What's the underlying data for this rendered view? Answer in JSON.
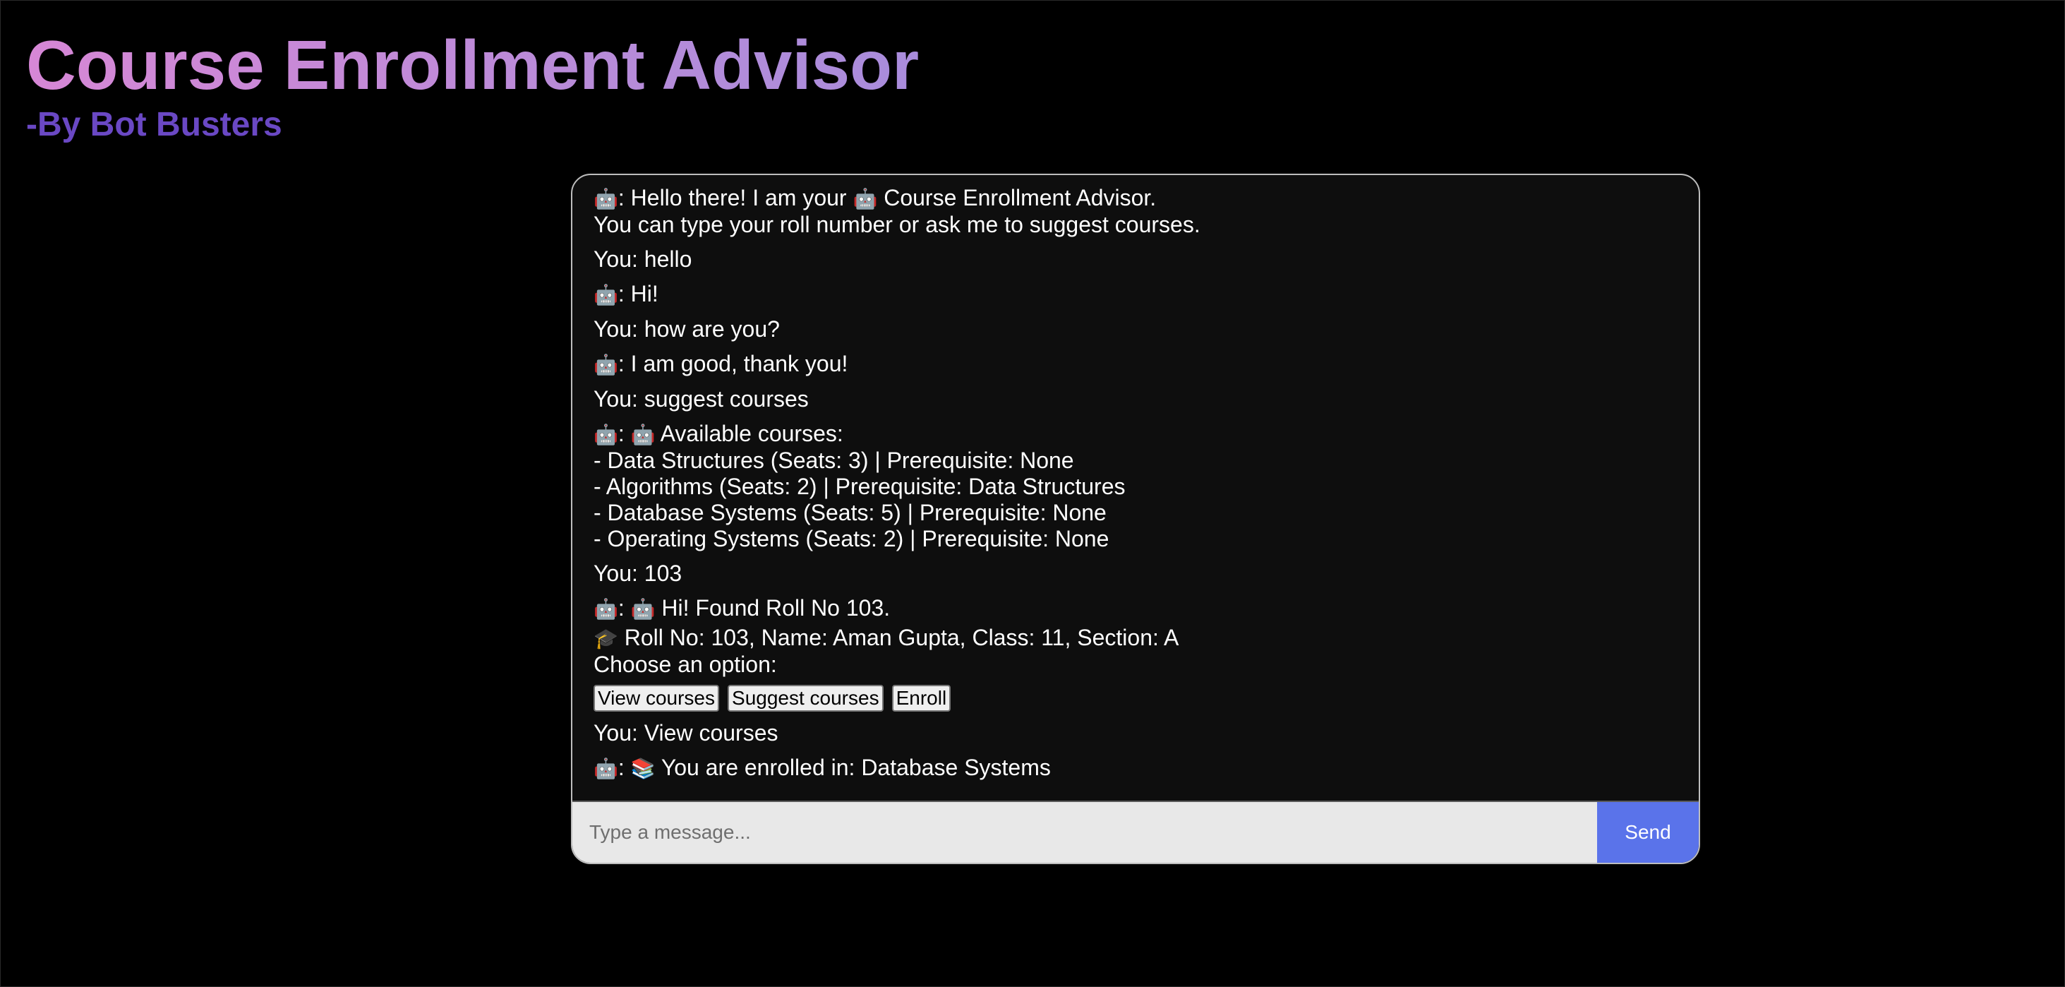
{
  "header": {
    "title": "Course Enrollment Advisor",
    "subtitle": "-By Bot Busters"
  },
  "icons": {
    "bot": "🤖",
    "grad_cap": "🎓",
    "books": "📚"
  },
  "chat": {
    "messages": [
      {
        "line1": ": Hello there! I am your ",
        "line1b": " Course Enrollment Advisor.",
        "line2": "You can type your roll number or ask me to suggest courses."
      },
      {
        "text": "You: hello"
      },
      {
        "text": ": Hi!"
      },
      {
        "text": "You: how are you?"
      },
      {
        "text": ": I am good, thank you!"
      },
      {
        "text": "You: suggest courses"
      },
      {
        "head": " Available courses:",
        "lines": [
          "- Data Structures (Seats: 3) | Prerequisite: None",
          "- Algorithms (Seats: 2) | Prerequisite: Data Structures",
          "- Database Systems (Seats: 5) | Prerequisite: None",
          "- Operating Systems (Seats: 2) | Prerequisite: None"
        ]
      },
      {
        "text": "You: 103"
      },
      {
        "head": " Hi! Found Roll No 103.",
        "line2": " Roll No: 103, Name: Aman Gupta, Class: 11, Section: A",
        "line3": "Choose an option:"
      },
      {
        "text": "You: View courses"
      },
      {
        "text": " You are enrolled in: Database Systems"
      }
    ],
    "options": [
      "View courses",
      "Suggest courses",
      "Enroll"
    ]
  },
  "input": {
    "placeholder": "Type a message...",
    "send_label": "Send"
  },
  "colors": {
    "background": "#000000",
    "chat_bg": "#0e0e0e",
    "send_button": "#5a73ea",
    "subtitle": "#6a48c4"
  }
}
